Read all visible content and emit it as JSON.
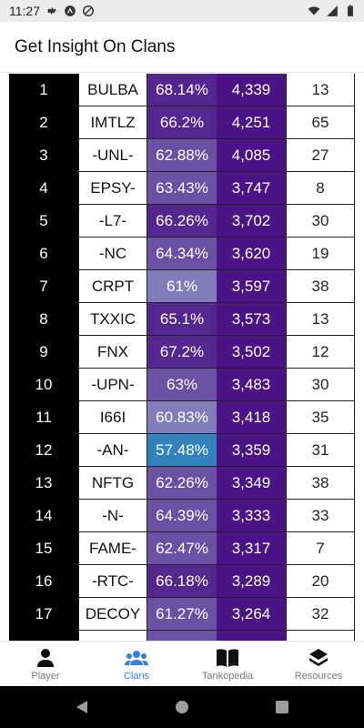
{
  "status_bar": {
    "time": "11:27"
  },
  "header": {
    "title": "Get Insight On Clans"
  },
  "colors": {
    "rating_bg": "#4a1486",
    "wr_dark": "#54278f",
    "wr_mid": "#6a51a3",
    "wr_light": "#807dba",
    "wr_blue": "#3182bd"
  },
  "clans": [
    {
      "rank": "1",
      "tag": "BULBA",
      "winrate": "68.14%",
      "rating": "4,339",
      "count": "13",
      "wr_color": "#54278f"
    },
    {
      "rank": "2",
      "tag": "IMTLZ",
      "winrate": "66.2%",
      "rating": "4,251",
      "count": "65",
      "wr_color": "#54278f"
    },
    {
      "rank": "3",
      "tag": "-UNL-",
      "winrate": "62.88%",
      "rating": "4,085",
      "count": "27",
      "wr_color": "#6a51a3"
    },
    {
      "rank": "4",
      "tag": "EPSY-",
      "winrate": "63.43%",
      "rating": "3,747",
      "count": "8",
      "wr_color": "#6a51a3"
    },
    {
      "rank": "5",
      "tag": "-L7-",
      "winrate": "66.26%",
      "rating": "3,702",
      "count": "30",
      "wr_color": "#54278f"
    },
    {
      "rank": "6",
      "tag": "-NC",
      "winrate": "64.34%",
      "rating": "3,620",
      "count": "19",
      "wr_color": "#6a51a3"
    },
    {
      "rank": "7",
      "tag": "CRPT",
      "winrate": "61%",
      "rating": "3,597",
      "count": "38",
      "wr_color": "#807dba"
    },
    {
      "rank": "8",
      "tag": "TXXIC",
      "winrate": "65.1%",
      "rating": "3,573",
      "count": "13",
      "wr_color": "#54278f"
    },
    {
      "rank": "9",
      "tag": "FNX",
      "winrate": "67.2%",
      "rating": "3,502",
      "count": "12",
      "wr_color": "#54278f"
    },
    {
      "rank": "10",
      "tag": "-UPN-",
      "winrate": "63%",
      "rating": "3,483",
      "count": "30",
      "wr_color": "#6a51a3"
    },
    {
      "rank": "11",
      "tag": "I66I",
      "winrate": "60.83%",
      "rating": "3,418",
      "count": "35",
      "wr_color": "#807dba"
    },
    {
      "rank": "12",
      "tag": "-AN-",
      "winrate": "57.48%",
      "rating": "3,359",
      "count": "31",
      "wr_color": "#3182bd"
    },
    {
      "rank": "13",
      "tag": "NFTG",
      "winrate": "62.26%",
      "rating": "3,349",
      "count": "38",
      "wr_color": "#6a51a3"
    },
    {
      "rank": "14",
      "tag": "-N-",
      "winrate": "64.39%",
      "rating": "3,333",
      "count": "33",
      "wr_color": "#6a51a3"
    },
    {
      "rank": "15",
      "tag": "FAME-",
      "winrate": "62.47%",
      "rating": "3,317",
      "count": "7",
      "wr_color": "#6a51a3"
    },
    {
      "rank": "16",
      "tag": "-RTC-",
      "winrate": "66.18%",
      "rating": "3,289",
      "count": "20",
      "wr_color": "#54278f"
    },
    {
      "rank": "17",
      "tag": "DECOY",
      "winrate": "61.27%",
      "rating": "3,264",
      "count": "32",
      "wr_color": "#6a51a3"
    },
    {
      "rank": "",
      "tag": "",
      "winrate": "",
      "rating": "",
      "count": "",
      "wr_color": "#6a51a3"
    }
  ],
  "bottom_nav": {
    "items": [
      {
        "label": "Player",
        "icon": "person-icon"
      },
      {
        "label": "Clans",
        "icon": "group-icon",
        "active": true
      },
      {
        "label": "Tankopedia",
        "icon": "book-icon"
      },
      {
        "label": "Resources",
        "icon": "layers-icon"
      }
    ]
  }
}
